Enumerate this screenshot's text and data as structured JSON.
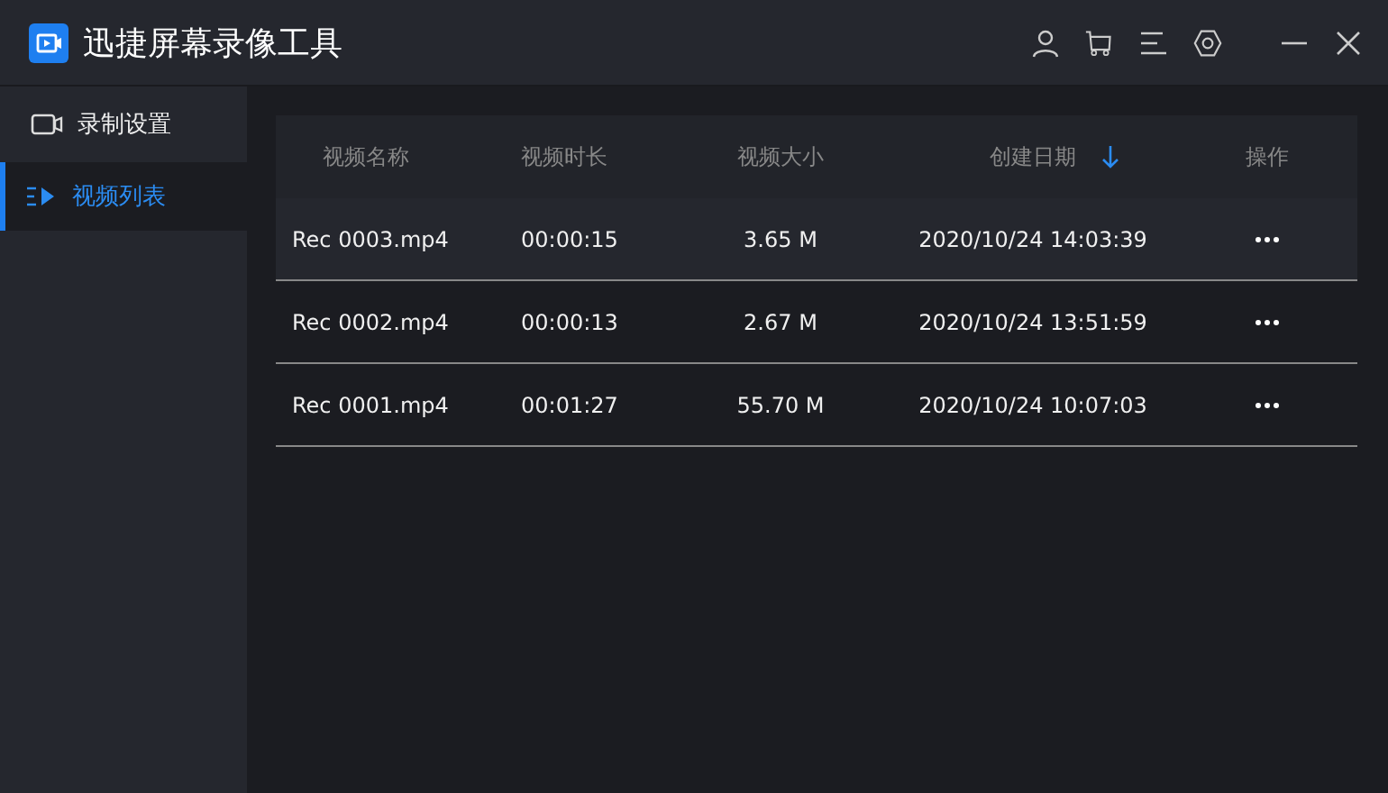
{
  "window": {
    "title": "迅捷屏幕录像工具"
  },
  "sidebar": {
    "items": [
      {
        "label": "录制设置",
        "kind": "camera",
        "selected": false
      },
      {
        "label": "视频列表",
        "kind": "list",
        "selected": true
      }
    ]
  },
  "table": {
    "columns": [
      {
        "label": "视频名称",
        "sorted": false
      },
      {
        "label": "视频时长",
        "sorted": false
      },
      {
        "label": "视频大小",
        "sorted": false
      },
      {
        "label": "创建日期",
        "sorted": true
      },
      {
        "label": "操作",
        "sorted": false
      }
    ],
    "rows": [
      {
        "name": "Rec 0003.mp4",
        "duration": "00:00:15",
        "size": "3.65 M",
        "date": "2020/10/24 14:03:39",
        "selected": true
      },
      {
        "name": "Rec 0002.mp4",
        "duration": "00:00:13",
        "size": "2.67 M",
        "date": "2020/10/24 13:51:59",
        "selected": false
      },
      {
        "name": "Rec 0001.mp4",
        "duration": "00:01:27",
        "size": "55.70 M",
        "date": "2020/10/24 10:07:03",
        "selected": false
      }
    ]
  }
}
